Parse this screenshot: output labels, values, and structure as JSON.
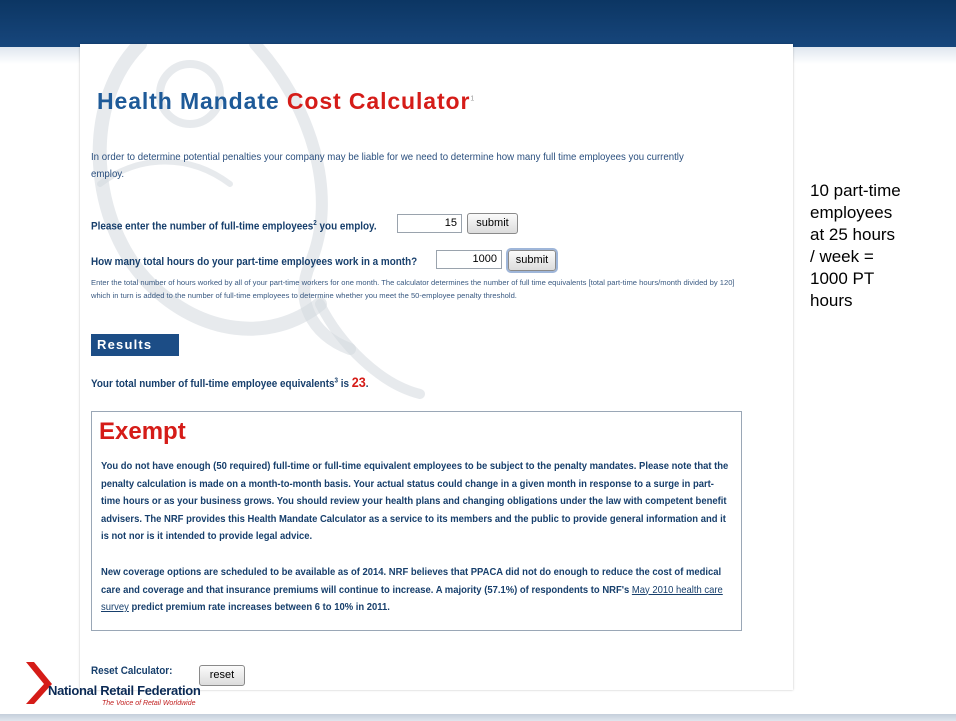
{
  "slide": {
    "side_note": "10 part-time\nemployees\nat 25 hours\n/ week =\n1000 PT\nhours"
  },
  "logo": {
    "name": "National Retail Federation",
    "tagline": "The Voice of Retail Worldwide"
  },
  "calculator": {
    "title_part1": "Health Mandate",
    "title_part2": "Cost Calculator",
    "title_footnote": "1",
    "intro": "In order to determine potential penalties your company may be liable for we need to determine how many full time employees you currently employ.",
    "fulltime": {
      "label": "Please enter the number of full-time employees",
      "footnote": "2",
      "label_suffix": " you employ.",
      "value": "15",
      "submit_label": "submit"
    },
    "parttime": {
      "label": "How many total hours do your part-time employees work in a month?",
      "value": "1000",
      "submit_label": "submit",
      "note": "Enter the total number of hours worked by all of your part-time workers for one month. The calculator determines the number of full time equivalents [total part-time hours/month divided by 120] which in turn is added to the number of full-time employees to determine whether you meet the 50-employee penalty threshold."
    },
    "results": {
      "header": "Results",
      "total_label": "Your total number of full-time employee equivalents",
      "total_footnote": "3",
      "total_label_suffix": " is ",
      "total_value": "23",
      "total_end": "."
    },
    "exempt": {
      "title": "Exempt",
      "paragraph1": "You do not have enough (50 required) full-time or full-time equivalent employees to be subject to the penalty mandates. Please note that the penalty calculation is made on a month-to-month basis. Your actual status could change in a given month in response to a surge in part-time hours or as your business grows. You should review your health plans and changing obligations under the law with competent benefit advisers. The NRF provides this Health Mandate Calculator as a service to its members and the public to provide general information and it is not nor is it intended to provide legal advice.",
      "paragraph2_before": "New coverage options are scheduled to be available as of 2014. NRF believes that PPACA did not do enough to reduce the cost of medical care and coverage and that insurance premiums will continue to increase. A majority (57.1%) of respondents to NRF's ",
      "paragraph2_link": "May 2010 health care survey",
      "paragraph2_after": " predict premium rate increases between 6 to 10% in 2011."
    },
    "reset": {
      "label": "Reset Calculator:",
      "button_label": "reset"
    }
  },
  "colors": {
    "band": "#0c3663",
    "title_blue": "#1e5a98",
    "accent_red": "#d51c18",
    "results_bg": "#1c4d86"
  }
}
